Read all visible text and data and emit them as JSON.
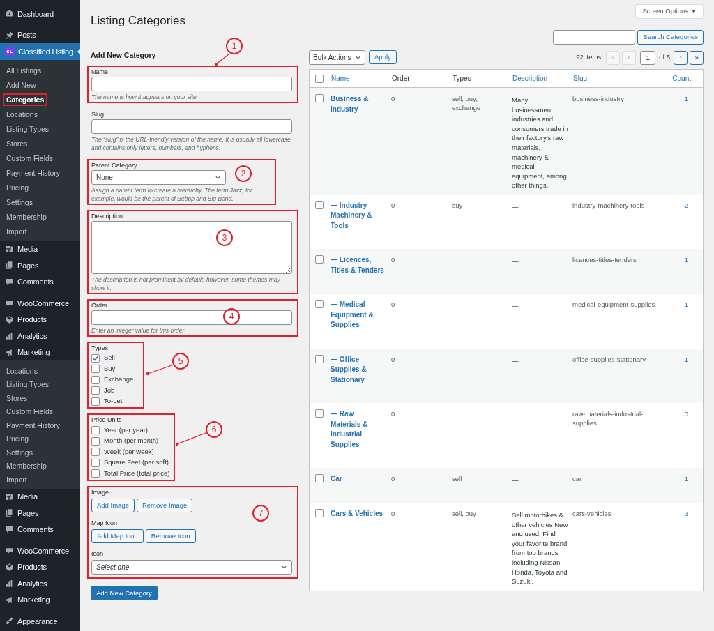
{
  "sidebar": [
    {
      "kind": "dashboard",
      "label": "Dashboard",
      "active": false,
      "group_start": false
    },
    {
      "kind": "pin",
      "label": "Posts",
      "active": false,
      "group_start": true
    },
    {
      "kind": "logo",
      "label": "Classified Listing",
      "logo_text": "cL",
      "active": true,
      "group_start": false
    },
    {
      "kind": "submenu",
      "items": [
        {
          "label": "All Listings",
          "selected": false,
          "annotated": false
        },
        {
          "label": "Add New",
          "selected": false,
          "annotated": false
        },
        {
          "label": "Categories",
          "selected": true,
          "annotated": true
        },
        {
          "label": "Locations",
          "selected": false,
          "annotated": false
        },
        {
          "label": "Listing Types",
          "selected": false,
          "annotated": false
        },
        {
          "label": "Stores",
          "selected": false,
          "annotated": false
        },
        {
          "label": "Custom Fields",
          "selected": false,
          "annotated": false
        },
        {
          "label": "Payment History",
          "selected": false,
          "annotated": false
        },
        {
          "label": "Pricing",
          "selected": false,
          "annotated": false
        },
        {
          "label": "Settings",
          "selected": false,
          "annotated": false
        },
        {
          "label": "Membership",
          "selected": false,
          "annotated": false
        },
        {
          "label": "Import",
          "selected": false,
          "annotated": false
        }
      ]
    },
    {
      "kind": "media",
      "label": "Media",
      "active": false,
      "group_start": false
    },
    {
      "kind": "pages",
      "label": "Pages",
      "active": false,
      "group_start": false
    },
    {
      "kind": "comments",
      "label": "Comments",
      "active": false,
      "group_start": false
    },
    {
      "kind": "woo",
      "label": "WooCommerce",
      "active": false,
      "group_start": true
    },
    {
      "kind": "products",
      "label": "Products",
      "active": false,
      "group_start": false
    },
    {
      "kind": "analytics",
      "label": "Analytics",
      "active": false,
      "group_start": false
    },
    {
      "kind": "marketing",
      "label": "Marketing",
      "active": false,
      "group_start": false
    },
    {
      "kind": "submenu",
      "items": [
        {
          "label": "Locations",
          "selected": false,
          "annotated": false
        },
        {
          "label": "Listing Types",
          "selected": false,
          "annotated": false
        },
        {
          "label": "Stores",
          "selected": false,
          "annotated": false
        },
        {
          "label": "Custom Fields",
          "selected": false,
          "annotated": false
        },
        {
          "label": "Payment History",
          "selected": false,
          "annotated": false
        },
        {
          "label": "Pricing",
          "selected": false,
          "annotated": false
        },
        {
          "label": "Settings",
          "selected": false,
          "annotated": false
        },
        {
          "label": "Membership",
          "selected": false,
          "annotated": false
        },
        {
          "label": "Import",
          "selected": false,
          "annotated": false
        }
      ]
    },
    {
      "kind": "media",
      "label": "Media",
      "active": false,
      "group_start": false
    },
    {
      "kind": "pages",
      "label": "Pages",
      "active": false,
      "group_start": false
    },
    {
      "kind": "comments",
      "label": "Comments",
      "active": false,
      "group_start": false
    },
    {
      "kind": "woo",
      "label": "WooCommerce",
      "active": false,
      "group_start": true
    },
    {
      "kind": "products",
      "label": "Products",
      "active": false,
      "group_start": false
    },
    {
      "kind": "analytics",
      "label": "Analytics",
      "active": false,
      "group_start": false
    },
    {
      "kind": "marketing",
      "label": "Marketing",
      "active": false,
      "group_start": false
    },
    {
      "kind": "brush",
      "label": "Appearance",
      "active": false,
      "group_start": true
    }
  ],
  "screen_options": "Screen Options",
  "title": "Listing Categories",
  "form": {
    "heading": "Add New Category",
    "sections": [
      {
        "kind": "name",
        "label": "Name",
        "hint": "The name is how it appears on your site.",
        "callout": "1"
      },
      {
        "kind": "slug",
        "label": "Slug",
        "hint": "The “slug” is the URL-friendly version of the name. It is usually all lowercase and contains only letters, numbers, and hyphens."
      },
      {
        "kind": "parent",
        "label": "Parent Category",
        "value": "None",
        "hint": "Assign a parent term to create a hierarchy. The term Jazz, for example, would be the parent of Bebop and Big Band.",
        "callout": "2"
      },
      {
        "kind": "description",
        "label": "Description",
        "hint": "The description is not prominent by default; however, some themes may show it.",
        "callout": "3"
      },
      {
        "kind": "order",
        "label": "Order",
        "hint": "Enter an integer value for this order",
        "callout": "4"
      },
      {
        "kind": "types",
        "label": "Types",
        "options": [
          {
            "label": "Sell",
            "checked": true
          },
          {
            "label": "Buy",
            "checked": false
          },
          {
            "label": "Exchange",
            "checked": false
          },
          {
            "label": "Job",
            "checked": false
          },
          {
            "label": "To-Let",
            "checked": false
          }
        ],
        "callout": "5"
      },
      {
        "kind": "price_units",
        "label": "Price Units",
        "options": [
          {
            "label": "Year (per year)",
            "checked": false
          },
          {
            "label": "Month (per month)",
            "checked": false
          },
          {
            "label": "Week (per week)",
            "checked": false
          },
          {
            "label": "Square Feet (per sqft)",
            "checked": false
          },
          {
            "label": "Total Price (total price)",
            "checked": false
          }
        ],
        "callout": "6"
      },
      {
        "kind": "media",
        "callout": "7",
        "parts": [
          {
            "kind": "buttons",
            "label": "Image",
            "buttons": [
              "Add Image",
              "Remove Image"
            ]
          },
          {
            "kind": "buttons",
            "label": "Map Icon",
            "buttons": [
              "Add Map Icon",
              "Remove Icon"
            ]
          },
          {
            "kind": "select",
            "label": "Icon",
            "value": "Select one"
          }
        ]
      }
    ],
    "submit": "Add New Category"
  },
  "search": {
    "button": "Search Categories"
  },
  "toolbar": {
    "bulk_actions": "Bulk Actions",
    "apply": "Apply",
    "items_count": "92 items",
    "first": {
      "label": "«",
      "disabled": true
    },
    "prev": {
      "label": "‹",
      "disabled": true
    },
    "page": "1",
    "of_pages": "of 5",
    "next": {
      "label": "›",
      "disabled": false
    },
    "last": {
      "label": "»",
      "disabled": false
    }
  },
  "table": {
    "select_all_checked": false,
    "columns": [
      {
        "label": "Name",
        "sortable": true
      },
      {
        "label": "Order",
        "sortable": false
      },
      {
        "label": "Types",
        "sortable": false
      },
      {
        "label": "Description",
        "sortable": true
      },
      {
        "label": "Slug",
        "sortable": true
      },
      {
        "label": "Count",
        "sortable": true
      }
    ],
    "rows": [
      {
        "checked": false,
        "name": "Business & Industry",
        "order": "0",
        "types": "sell, buy, exchange",
        "description": "Many businessmen, industries and consumers trade in their factory’s raw materials, machinery & medical equipment, among other things.",
        "slug": "business-industry",
        "count": "1"
      },
      {
        "checked": false,
        "name": "— Industry Machinery & Tools",
        "order": "0",
        "types": "buy",
        "description": "—",
        "slug": "industry-machinery-tools",
        "count": "2"
      },
      {
        "checked": false,
        "name": "— Licences, Titles & Tenders",
        "order": "0",
        "description": "—",
        "slug": "licences-titles-tenders",
        "count": "1"
      },
      {
        "checked": false,
        "name": "— Medical Equipment & Supplies",
        "order": "0",
        "description": "—",
        "slug": "medical-equipment-supplies",
        "count": "1"
      },
      {
        "checked": false,
        "name": "— Office Supplies & Stationary",
        "order": "0",
        "description": "—",
        "slug": "office-supplies-stationary",
        "count": "1"
      },
      {
        "checked": false,
        "name": "— Raw Materials & Industrial Supplies",
        "order": "0",
        "description": "—",
        "slug": "raw-materials-industrial-supplies",
        "count": "0"
      },
      {
        "checked": false,
        "name": "Car",
        "order": "0",
        "types": "sell",
        "description": "—",
        "slug": "car",
        "count": "1"
      },
      {
        "checked": false,
        "name": "Cars & Vehicles",
        "order": "0",
        "types": "sell, buy",
        "description": "Sell motorbikes & other vehicles New and used. Find your favorite brand from top brands including Nissan, Honda, Toyota and Suzuki.",
        "slug": "cars-vehicles",
        "count": "3"
      }
    ]
  }
}
